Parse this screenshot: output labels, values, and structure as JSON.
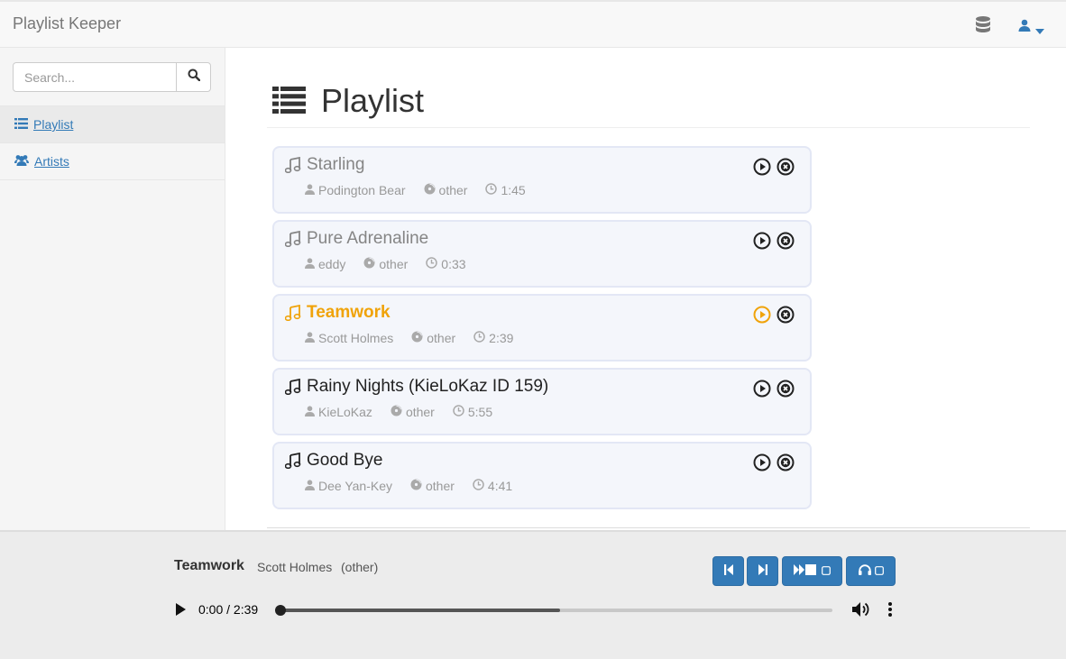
{
  "navbar": {
    "brand": "Playlist Keeper",
    "db_icon": "database-icon",
    "user_icon": "user-icon"
  },
  "sidebar": {
    "search": {
      "placeholder": "Search...",
      "value": ""
    },
    "items": [
      {
        "label": "Playlist",
        "icon": "list-icon",
        "active": true
      },
      {
        "label": "Artists",
        "icon": "users-icon",
        "active": false
      }
    ]
  },
  "page": {
    "title": "Playlist",
    "title_icon": "list-icon"
  },
  "colors": {
    "accent": "#f0a30a",
    "primary": "#337ab7",
    "card_bg": "#f4f6fb",
    "card_border": "#e3e7f5"
  },
  "tracks": [
    {
      "title": "Starling",
      "artist": "Podington Bear",
      "genre": "other",
      "duration": "1:45",
      "state": "played"
    },
    {
      "title": "Pure Adrenaline",
      "artist": "eddy",
      "genre": "other",
      "duration": "0:33",
      "state": "played"
    },
    {
      "title": "Teamwork",
      "artist": "Scott Holmes",
      "genre": "other",
      "duration": "2:39",
      "state": "current"
    },
    {
      "title": "Rainy Nights (KieLoKaz ID 159)",
      "artist": "KieLoKaz",
      "genre": "other",
      "duration": "5:55",
      "state": "upcoming"
    },
    {
      "title": "Good Bye",
      "artist": "Dee Yan-Key",
      "genre": "other",
      "duration": "4:41",
      "state": "upcoming"
    }
  ],
  "player": {
    "title": "Teamwork",
    "artist": "Scott Holmes",
    "genre": "(other)",
    "time": "0:00 / 2:39",
    "position_fraction": 0.0,
    "buffered_fraction": 0.51,
    "controls": [
      "skip-back-icon",
      "skip-forward-icon",
      "autoplay-toggle",
      "headphones-toggle"
    ]
  }
}
